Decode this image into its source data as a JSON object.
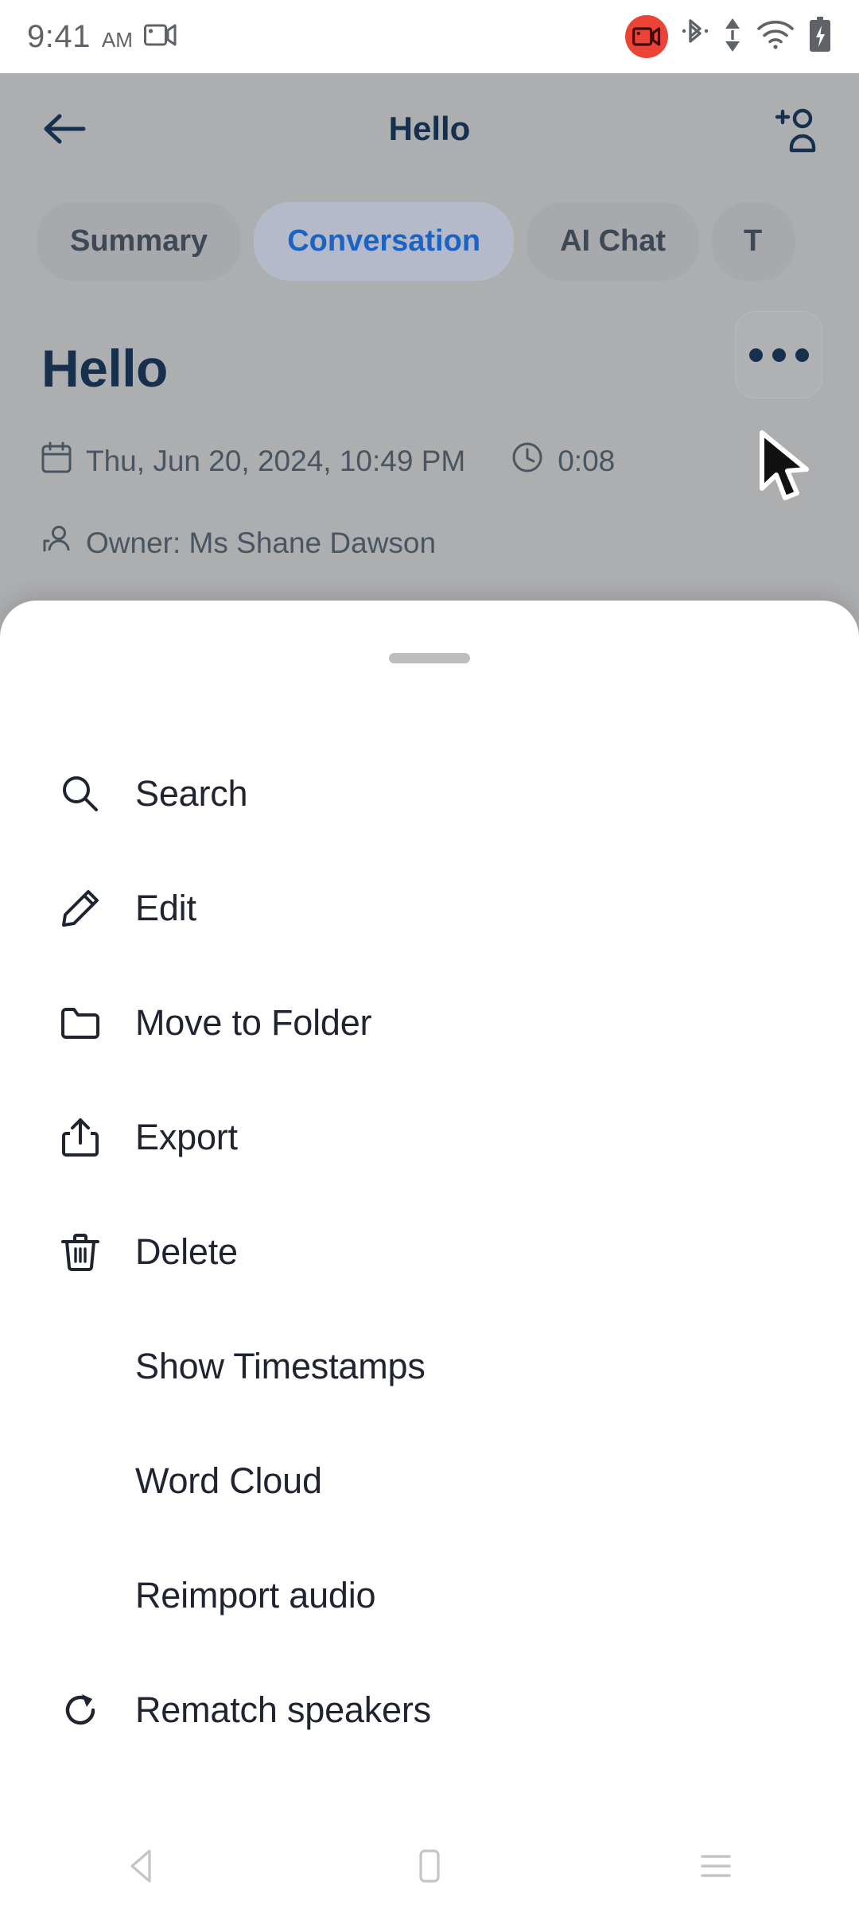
{
  "status_bar": {
    "time": "9:41",
    "ampm": "AM",
    "left_icons": [
      "screen-record-small-icon"
    ],
    "right_icons": [
      "screen-record-badge-icon",
      "bluetooth-icon",
      "data-transfer-icon",
      "wifi-icon",
      "battery-charging-icon"
    ],
    "record_badge_color": "#eb4335"
  },
  "app_bar": {
    "back_label": "back-arrow",
    "title": "Hello",
    "action_label": "add-person"
  },
  "tabs": [
    {
      "label": "Summary",
      "active": false
    },
    {
      "label": "Conversation",
      "active": true
    },
    {
      "label": "AI Chat",
      "active": false
    },
    {
      "label": "T",
      "active": false
    }
  ],
  "record": {
    "title": "Hello",
    "date": "Thu, Jun 20, 2024, 10:49 PM",
    "duration": "0:08",
    "owner": "Owner: Ms Shane Dawson",
    "menu_button": "more-options"
  },
  "sheet": {
    "items": [
      {
        "label": "Search",
        "icon": "search-icon"
      },
      {
        "label": "Edit",
        "icon": "pencil-icon"
      },
      {
        "label": "Move to Folder",
        "icon": "folder-icon"
      },
      {
        "label": "Export",
        "icon": "share-upload-icon"
      },
      {
        "label": "Delete",
        "icon": "trash-icon"
      },
      {
        "label": "Show Timestamps",
        "icon": ""
      },
      {
        "label": "Word Cloud",
        "icon": ""
      },
      {
        "label": "Reimport audio",
        "icon": ""
      },
      {
        "label": "Rematch speakers",
        "icon": "refresh-icon"
      }
    ]
  },
  "nav_bar": {
    "back": "nav-back",
    "home": "nav-home",
    "recents": "nav-recents"
  },
  "colors": {
    "accent_blue": "#1b63c4",
    "title_navy": "#16304e",
    "scrim": "#adaeb0",
    "sheet_bg": "#ffffff"
  }
}
